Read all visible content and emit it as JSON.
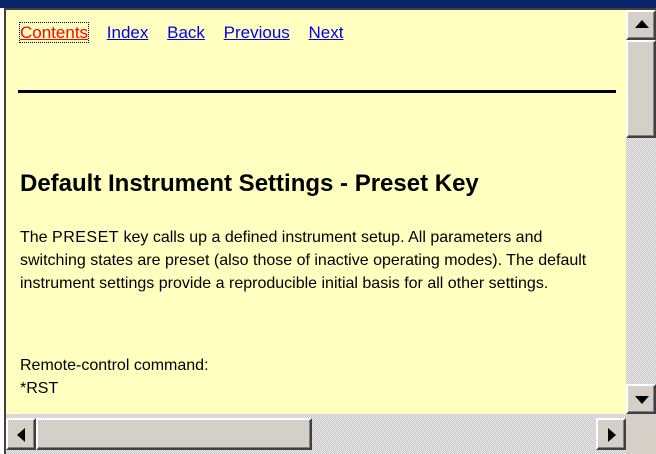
{
  "nav": {
    "contents": "Contents",
    "index": "Index",
    "back": "Back",
    "previous": "Previous",
    "next": "Next"
  },
  "content": {
    "heading": "Default Instrument Settings - Preset Key",
    "para_intro": "The ",
    "para_key": "PRESET",
    "para_rest": " key calls up a defined instrument setup. All parameters and switching states are preset (also those of inactive operating modes). The default instrument settings provide a reproducible initial basis for all other settings.",
    "remote_label": "Remote-control command:",
    "remote_command": "*RST"
  },
  "colors": {
    "page_background": "#ffffc0",
    "link": "#0000ee",
    "current_link": "#ff0000"
  },
  "scrollbars": {
    "vertical_icon_up": "up-arrow-icon",
    "vertical_icon_down": "down-arrow-icon",
    "horizontal_icon_left": "left-arrow-icon",
    "horizontal_icon_right": "right-arrow-icon"
  }
}
